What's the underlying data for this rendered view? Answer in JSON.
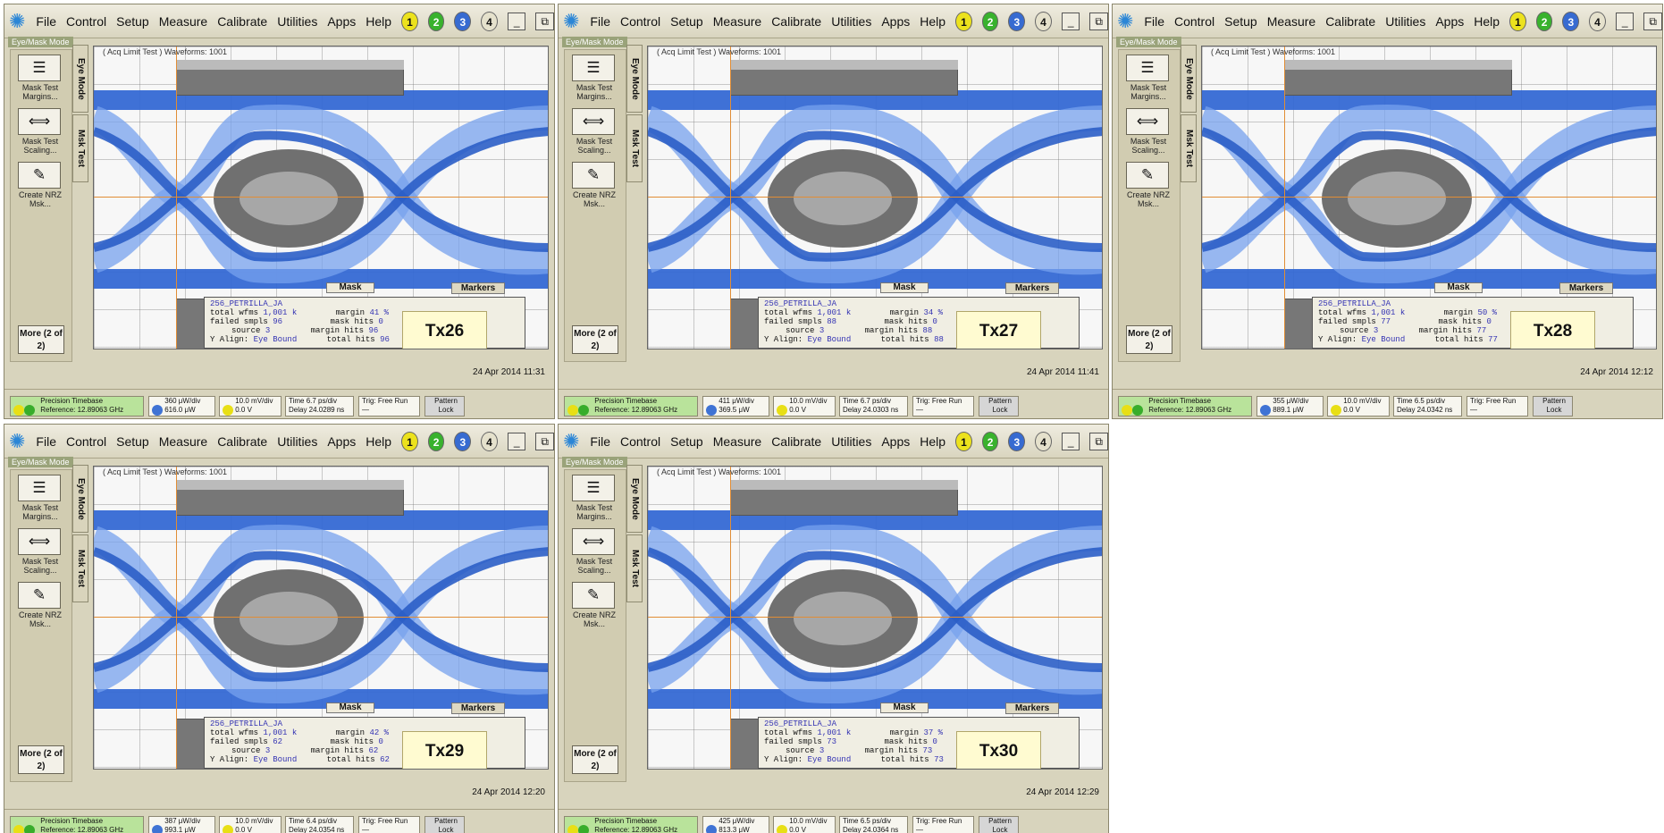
{
  "menu": {
    "items": [
      "File",
      "Control",
      "Setup",
      "Measure",
      "Calibrate",
      "Utilities",
      "Apps",
      "Help"
    ],
    "channels": [
      "1",
      "2",
      "3",
      "4"
    ],
    "minimize": "_",
    "restore": "⧉"
  },
  "mode": "Eye/Mask Mode",
  "left": {
    "mask_test_margins": "Mask Test Margins...",
    "mask_test_scaling": "Mask Test Scaling...",
    "create": "Create NRZ Msk...",
    "tabs": [
      "Eye Mode",
      "Msk Test"
    ],
    "more": "More\n(2 of 2)"
  },
  "screen": {
    "acq": "( Acq Limit Test ) Waveforms: 1001",
    "mask": "Mask",
    "markers": "Markers"
  },
  "panels": [
    {
      "tx": "Tx26",
      "date": "24 Apr 2014 11:31",
      "source": "256_PETRILLA_JA",
      "total": "1,001 k",
      "failed": "96",
      "margin": "41 %",
      "mask_hits": "0",
      "margin_hits": "96",
      "total_hits": "96",
      "timebase": "Precision Timebase",
      "ref": "Reference: 12.89063 GHz",
      "ch1_scale": "360 μW/div",
      "ch1_offset": "616.0 μW",
      "ch2": "10.0 mV/div",
      "ch2_off": "0.0 V",
      "time": "Time 6.7 ps/div",
      "delay": "Delay 24.0289 ns",
      "trig": "Trig: Free Run",
      "pattern": "Pattern Lock"
    },
    {
      "tx": "Tx27",
      "date": "24 Apr 2014 11:41",
      "source": "256_PETRILLA_JA",
      "total": "1,001 k",
      "failed": "88",
      "margin": "34 %",
      "mask_hits": "0",
      "margin_hits": "88",
      "total_hits": "88",
      "timebase": "Precision Timebase",
      "ref": "Reference: 12.89063 GHz",
      "ch1_scale": "411 μW/div",
      "ch1_offset": "369.5 μW",
      "ch2": "10.0 mV/div",
      "ch2_off": "0.0 V",
      "time": "Time 6.7 ps/div",
      "delay": "Delay 24.0303 ns",
      "trig": "Trig: Free Run",
      "pattern": "Pattern Lock"
    },
    {
      "tx": "Tx28",
      "date": "24 Apr 2014 12:12",
      "source": "256_PETRILLA_JA",
      "total": "1,001 k",
      "failed": "77",
      "margin": "50 %",
      "mask_hits": "0",
      "margin_hits": "77",
      "total_hits": "77",
      "timebase": "Precision Timebase",
      "ref": "Reference: 12.89063 GHz",
      "ch1_scale": "355 μW/div",
      "ch1_offset": "889.1 μW",
      "ch2": "10.0 mV/div",
      "ch2_off": "0.0 V",
      "time": "Time 6.5 ps/div",
      "delay": "Delay 24.0342 ns",
      "trig": "Trig: Free Run",
      "pattern": "Pattern Lock"
    },
    {
      "tx": "Tx29",
      "date": "24 Apr 2014 12:20",
      "source": "256_PETRILLA_JA",
      "total": "1,001 k",
      "failed": "62",
      "margin": "42 %",
      "mask_hits": "0",
      "margin_hits": "62",
      "total_hits": "62",
      "timebase": "Precision Timebase",
      "ref": "Reference: 12.89063 GHz",
      "ch1_scale": "387 μW/div",
      "ch1_offset": "993.1 μW",
      "ch2": "10.0 mV/div",
      "ch2_off": "0.0 V",
      "time": "Time 6.4 ps/div",
      "delay": "Delay 24.0354 ns",
      "trig": "Trig: Free Run",
      "pattern": "Pattern Lock"
    },
    {
      "tx": "Tx30",
      "date": "24 Apr 2014 12:29",
      "source": "256_PETRILLA_JA",
      "total": "1,001 k",
      "failed": "73",
      "margin": "37 %",
      "mask_hits": "0",
      "margin_hits": "73",
      "total_hits": "73",
      "timebase": "Precision Timebase",
      "ref": "Reference: 12.89063 GHz",
      "ch1_scale": "425 μW/div",
      "ch1_offset": "813.3 μW",
      "ch2": "10.0 mV/div",
      "ch2_off": "0.0 V",
      "time": "Time 6.5 ps/div",
      "delay": "Delay 24.0364 ns",
      "trig": "Trig: Free Run",
      "pattern": "Pattern Lock"
    }
  ],
  "labels": {
    "total": "total wfms",
    "failed": "failed smpls",
    "source": "source",
    "source_val": "3",
    "yalign": "Y Align:",
    "yalign_val": "Eye Bound",
    "mask_hits": "mask hits",
    "margin": "margin",
    "margin_hits": "margin hits",
    "total_hits": "total hits"
  }
}
